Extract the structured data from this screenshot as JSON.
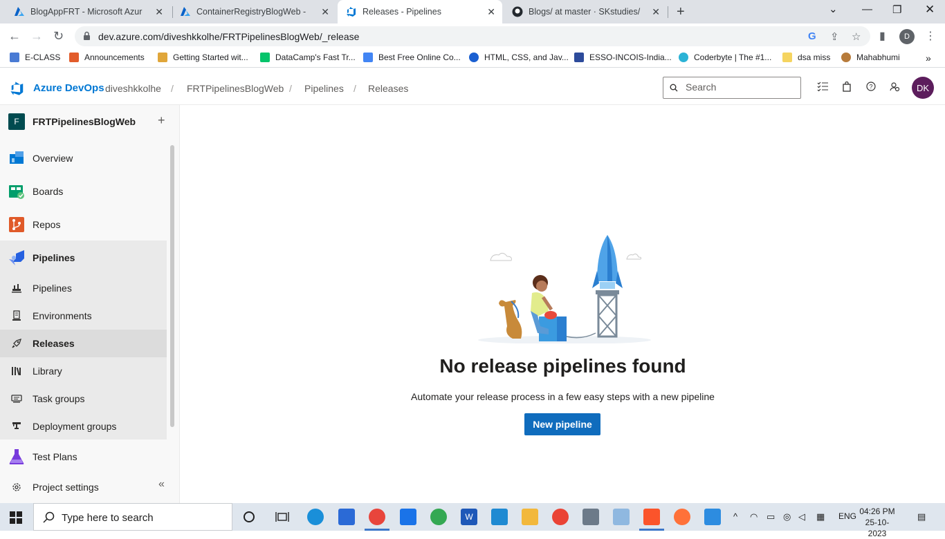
{
  "browser": {
    "tabs": [
      {
        "title": "BlogAppFRT - Microsoft Azure",
        "icon": "azure-icon",
        "active": false
      },
      {
        "title": "ContainerRegistryBlogWeb - Mic",
        "icon": "azure-icon",
        "active": false
      },
      {
        "title": "Releases - Pipelines",
        "icon": "devops-icon",
        "active": true
      },
      {
        "title": "Blogs/ at master · SKstudies/Blo",
        "icon": "github-icon",
        "active": false
      }
    ],
    "url": "dev.azure.com/diveshkkolhe/FRTPipelinesBlogWeb/_release",
    "profile_initial": "D",
    "bookmarks": [
      {
        "label": "E-CLASS",
        "color": "#4a7bd4"
      },
      {
        "label": "Announcements",
        "color": "#e25c2b"
      },
      {
        "label": "Getting Started wit...",
        "color": "#e0a63a"
      },
      {
        "label": "DataCamp's Fast Tr...",
        "color": "#05c46b"
      },
      {
        "label": "Best Free Online Co...",
        "color": "#4285f4"
      },
      {
        "label": "HTML, CSS, and Jav...",
        "color": "#1a5fd1"
      },
      {
        "label": "ESSO-INCOIS-India...",
        "color": "#2d4b9b"
      },
      {
        "label": "Coderbyte | The #1...",
        "color": "#2bb3d6"
      },
      {
        "label": "dsa miss",
        "color": "#f5d460"
      },
      {
        "label": "Mahabhumi",
        "color": "#b77b3b"
      }
    ]
  },
  "header": {
    "brand": "Azure DevOps",
    "breadcrumbs": [
      "diveshkkolhe",
      "FRTPipelinesBlogWeb",
      "Pipelines",
      "Releases"
    ],
    "separator": "/",
    "search_placeholder": "Search",
    "avatar": "DK"
  },
  "sidebar": {
    "project_initial": "F",
    "project_name": "FRTPipelinesBlogWeb",
    "add": "+",
    "items": [
      {
        "label": "Overview",
        "icon": "overview-icon"
      },
      {
        "label": "Boards",
        "icon": "boards-icon"
      },
      {
        "label": "Repos",
        "icon": "repos-icon"
      },
      {
        "label": "Pipelines",
        "icon": "pipelines-icon"
      },
      {
        "label": "Test Plans",
        "icon": "test-plans-icon"
      }
    ],
    "sub_items": [
      {
        "label": "Pipelines",
        "icon": "pipeline-sub-icon"
      },
      {
        "label": "Environments",
        "icon": "environments-icon"
      },
      {
        "label": "Releases",
        "icon": "releases-icon",
        "selected": true
      },
      {
        "label": "Library",
        "icon": "library-icon"
      },
      {
        "label": "Task groups",
        "icon": "task-groups-icon"
      },
      {
        "label": "Deployment groups",
        "icon": "deployment-groups-icon"
      }
    ],
    "settings": "Project settings",
    "collapse": "«"
  },
  "main": {
    "title": "No release pipelines found",
    "description": "Automate your release process in a few easy steps with a new pipeline",
    "button": "New pipeline"
  },
  "taskbar": {
    "search_placeholder": "Type here to search",
    "language": "ENG",
    "time": "04:26 PM",
    "date": "25-10-2023"
  }
}
